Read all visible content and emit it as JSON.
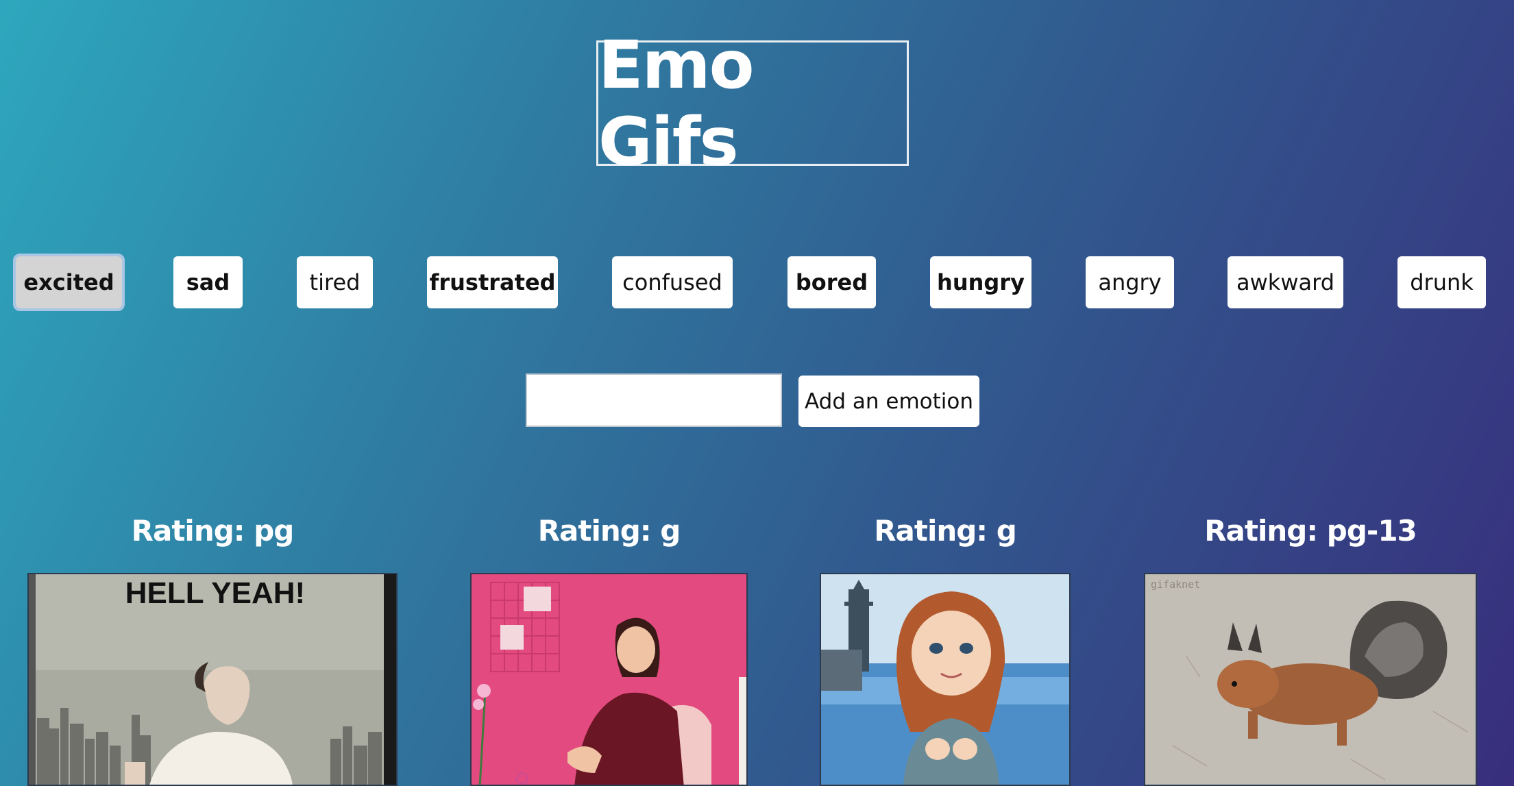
{
  "title": "Emo Gifs",
  "emotions": [
    "excited",
    "sad",
    "tired",
    "frustrated",
    "confused",
    "bored",
    "hungry",
    "angry",
    "awkward",
    "drunk"
  ],
  "add_emotion": {
    "input_value": "",
    "button_label": "Add an emotion"
  },
  "gifs": [
    {
      "rating_label": "Rating: pg",
      "caption": "HELL YEAH!"
    },
    {
      "rating_label": "Rating: g"
    },
    {
      "rating_label": "Rating: g"
    },
    {
      "rating_label": "Rating: pg-13",
      "watermark": "gifaknet"
    }
  ],
  "colors": {
    "background_start": "#2ea7bd",
    "background_end": "#382e7c",
    "button_bg": "#ffffff",
    "active_button_bg": "#d4d4d4"
  }
}
